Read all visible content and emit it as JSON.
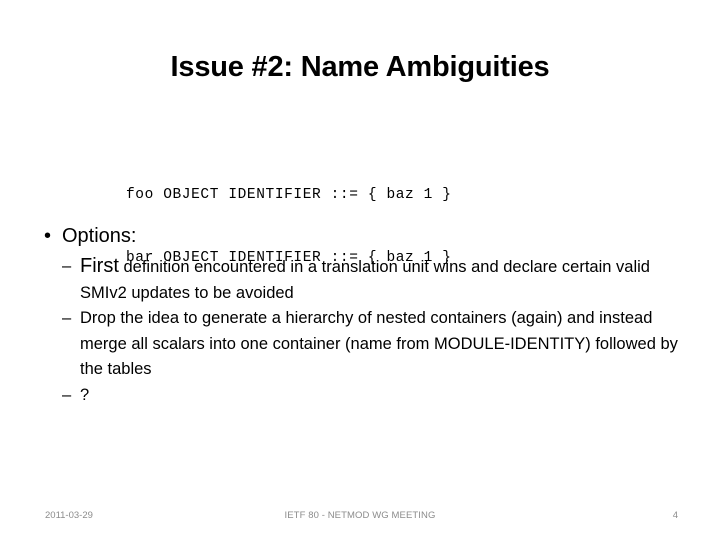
{
  "slide": {
    "title": "Issue #2: Name Ambiguities",
    "page_background": "#ffffff",
    "text_color": "#000000",
    "footer_color": "#8c8c8c"
  },
  "code_block": {
    "lines": [
      "foo OBJECT IDENTIFIER ::= { baz 1 }",
      "bar OBJECT IDENTIFIER ::= { baz 1 }"
    ]
  },
  "body": {
    "level1": {
      "bullet_glyph": "•",
      "label": "Options:"
    },
    "dash_glyph": "–",
    "level2": [
      {
        "lead": "First",
        "rest": " definition encountered in a translation unit wins and declare certain valid SMIv2 updates to be avoided"
      },
      {
        "lead": "",
        "rest": "Drop the idea to generate a hierarchy of nested containers (again) and instead merge all scalars into one container (name from MODULE-IDENTITY) followed by the tables"
      },
      {
        "lead": "",
        "rest": "?"
      }
    ]
  },
  "footer": {
    "date": "2011-03-29",
    "center": "IETF 80 - NETMOD WG MEETING",
    "page_number": "4"
  }
}
